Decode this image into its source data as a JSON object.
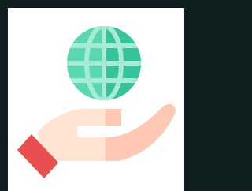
{
  "illustration": {
    "subject": "hand-holding-globe-icon",
    "colors": {
      "background_frame": "#0f1e1f",
      "card": "#ffffff",
      "globe_light": "#5ad6b0",
      "globe_dark": "#36c29a",
      "globe_lines": "#a6ecd4",
      "hand_light": "#ffe3d3",
      "hand_dark": "#ffc8b3",
      "cuff": "#e94f4f"
    }
  }
}
